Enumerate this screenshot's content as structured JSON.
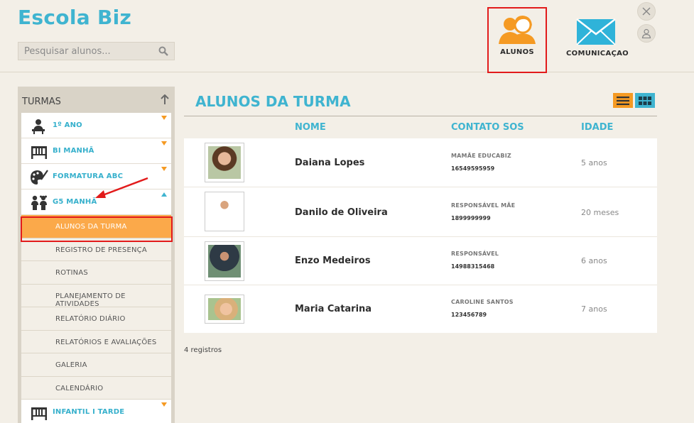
{
  "app": {
    "brand": "Escola Biz"
  },
  "search": {
    "placeholder": "Pesquisar alunos..."
  },
  "nav": [
    {
      "label": "ALUNOS",
      "icon": "students-icon",
      "selected": true
    },
    {
      "label": "COMUNICAÇAO",
      "icon": "envelope-icon",
      "selected": false
    }
  ],
  "sidebar": {
    "title": "TURMAS",
    "groups": [
      {
        "label": "1º ANO",
        "icon": "student-desk-icon",
        "expanded": false
      },
      {
        "label": "BI MANHÃ",
        "icon": "crib-icon",
        "expanded": false
      },
      {
        "label": "FORMATURA ABC",
        "icon": "palette-icon",
        "expanded": false
      },
      {
        "label": "G5 MANHÃ",
        "icon": "children-icon",
        "expanded": true
      },
      {
        "label": "INFANTIL I TARDE",
        "icon": "crib-icon",
        "expanded": false
      }
    ],
    "subitems": [
      {
        "label": "ALUNOS DA TURMA",
        "active": true
      },
      {
        "label": "REGISTRO DE PRESENÇA",
        "active": false
      },
      {
        "label": "ROTINAS",
        "active": false
      },
      {
        "label": "PLANEJAMENTO DE ATIVIDADES",
        "active": false
      },
      {
        "label": "RELATÓRIO DIÁRIO",
        "active": false
      },
      {
        "label": "RELATÓRIOS E AVALIAÇÕES",
        "active": false
      },
      {
        "label": "GALERIA",
        "active": false
      },
      {
        "label": "CALENDÁRIO",
        "active": false
      }
    ]
  },
  "main": {
    "title": "ALUNOS DA TURMA",
    "columns": {
      "name": "NOME",
      "contact": "CONTATO SOS",
      "age": "IDADE"
    },
    "students": [
      {
        "name": "Daiana Lopes",
        "contact_label": "MAMÃE EDUCABIZ",
        "contact_phone": "16549595959",
        "age": "5 anos"
      },
      {
        "name": "Danilo de Oliveira",
        "contact_label": "RESPONSÁVEL MÃE",
        "contact_phone": "1899999999",
        "age": "20 meses"
      },
      {
        "name": "Enzo Medeiros",
        "contact_label": "RESPONSÁVEL",
        "contact_phone": "14988315468",
        "age": "6 anos"
      },
      {
        "name": "Maria Catarina",
        "contact_label": "CAROLINE SANTOS",
        "contact_phone": "123456789",
        "age": "7 anos"
      }
    ],
    "count": "4 registros"
  },
  "colors": {
    "accent": "#3fb4d0",
    "orange": "#f59a23",
    "active": "#fba94a",
    "highlight": "#e21b1b"
  }
}
